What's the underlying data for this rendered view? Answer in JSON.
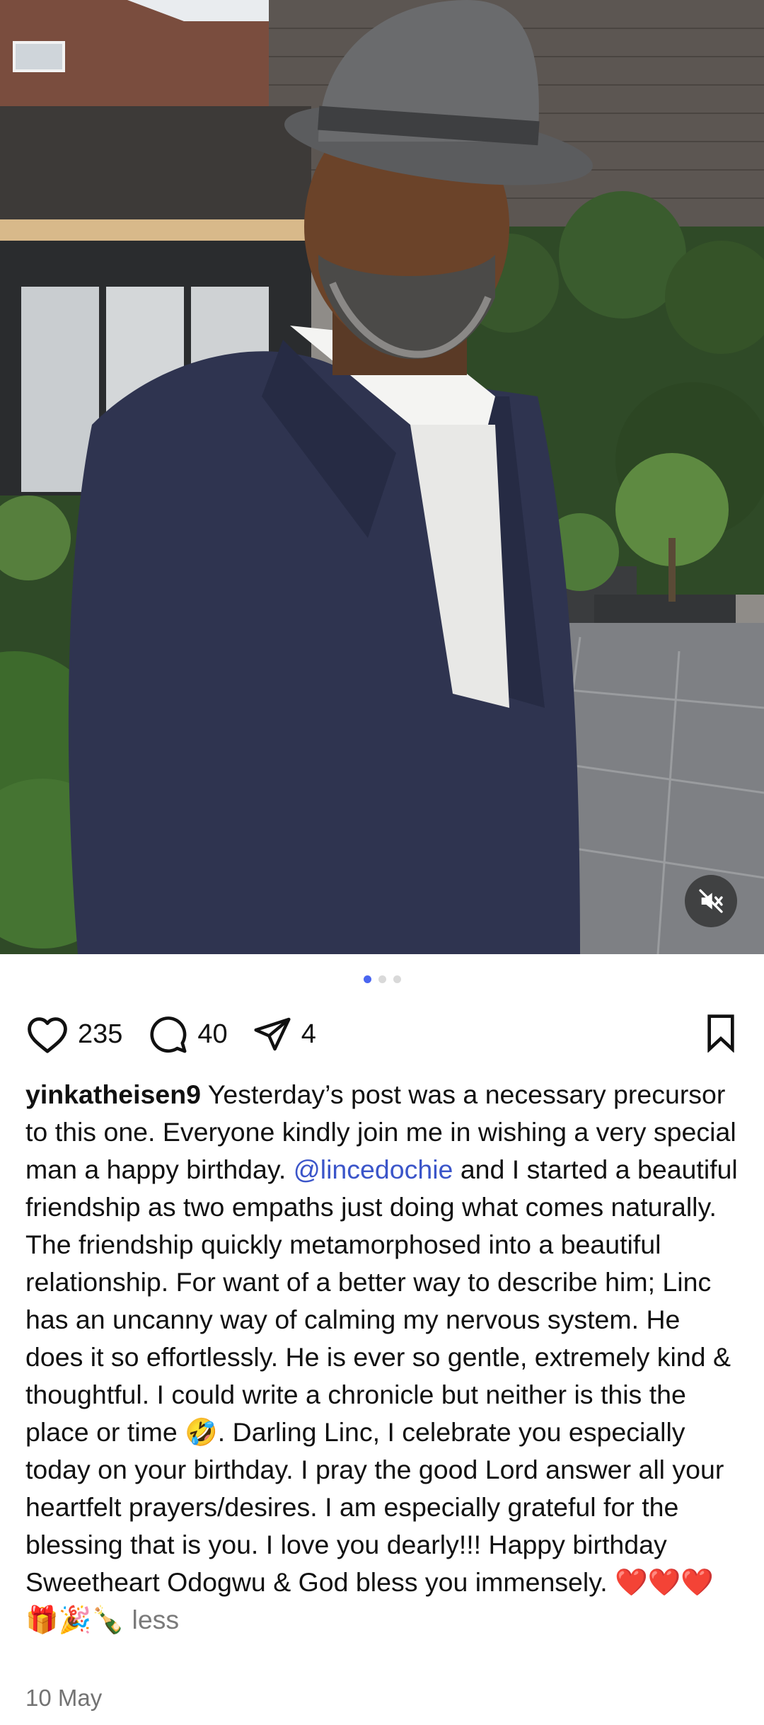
{
  "post": {
    "media": {
      "description_icon": "photo-of-man-in-fedora",
      "mute_icon": "speaker-muted-icon",
      "carousel": {
        "count": 3,
        "active_index": 0
      }
    },
    "actions": {
      "likes": "235",
      "comments": "40",
      "shares": "4",
      "like_icon": "heart-icon",
      "comment_icon": "comment-bubble-icon",
      "share_icon": "paper-plane-icon",
      "save_icon": "bookmark-icon"
    },
    "caption": {
      "username": "yinkatheisen9",
      "text_before_mention": " Yesterday’s post was a necessary precursor to this one. Everyone kindly join me in wishing a very special man a happy birthday. ",
      "mention": "@lincedochie",
      "text_after_mention": " and I started a beautiful friendship as two empaths just doing what comes naturally. The friendship quickly metamorphosed into a beautiful relationship. For want of a better way to describe him; Linc has an uncanny way of calming my nervous system. He does it so effortlessly. He is ever so gentle, extremely kind & thoughtful. I could write a chronicle but neither is this the place or time 🤣. Darling Linc, I celebrate you especially today on your birthday. I pray the good Lord answer all your heartfelt prayers/desires. I am especially grateful for the blessing that is you. I love you dearly!!! Happy birthday Sweetheart Odogwu & God bless you immensely. ❤️❤️❤️🎁🎉🍾",
      "less_label": "less"
    },
    "date": "10 May"
  },
  "colors": {
    "mention": "#3b55c9",
    "active_dot": "#4a66f0",
    "inactive_dot": "#d9d9d9",
    "muted_text": "#737373"
  }
}
